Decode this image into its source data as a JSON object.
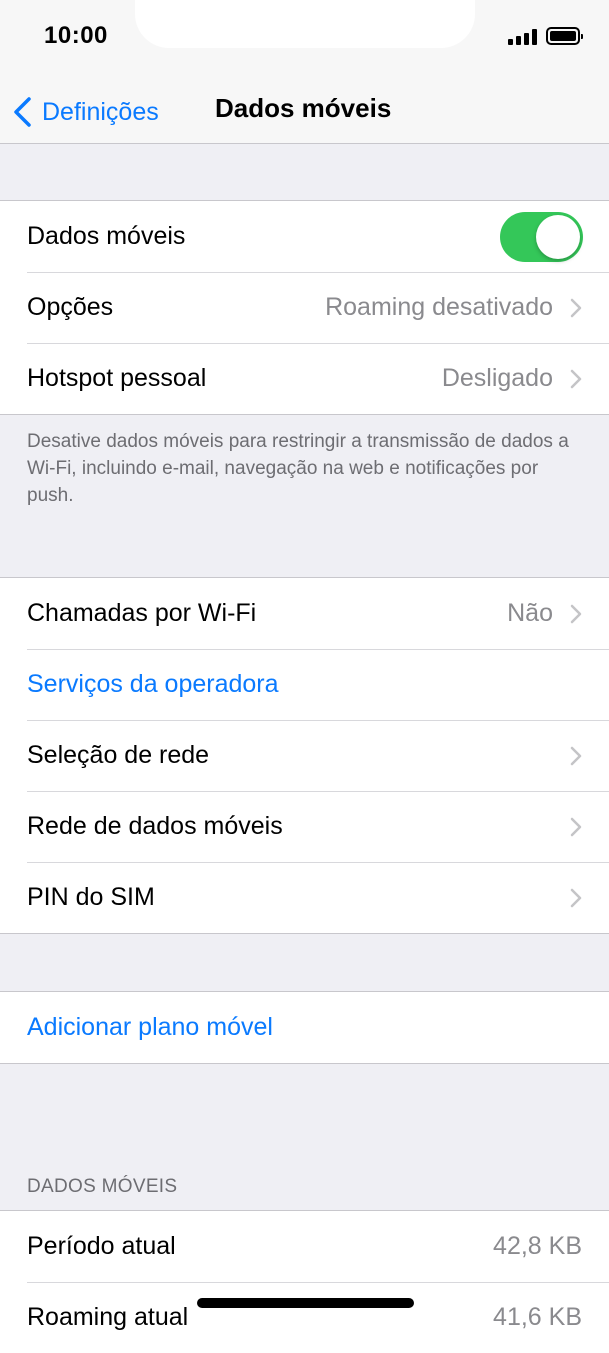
{
  "status_bar": {
    "time": "10:00"
  },
  "nav": {
    "back_label": "Definições",
    "title": "Dados móveis"
  },
  "group1": {
    "cellular_data_label": "Dados móveis",
    "cellular_data_enabled": true,
    "options_label": "Opções",
    "options_value": "Roaming desativado",
    "hotspot_label": "Hotspot pessoal",
    "hotspot_value": "Desligado"
  },
  "group1_footer": "Desative dados móveis para restringir a transmissão de dados a Wi-Fi, incluindo e-mail, navegação na web e notificações por push.",
  "group2": {
    "wifi_calling_label": "Chamadas por Wi-Fi",
    "wifi_calling_value": "Não",
    "carrier_services_label": "Serviços da operadora",
    "network_selection_label": "Seleção de rede",
    "cellular_network_label": "Rede de dados móveis",
    "sim_pin_label": "PIN do SIM"
  },
  "group3": {
    "add_plan_label": "Adicionar plano móvel"
  },
  "usage": {
    "header": "DADOS MÓVEIS",
    "current_period_label": "Período atual",
    "current_period_value": "42,8 KB",
    "roaming_label": "Roaming atual",
    "roaming_value": "41,6 KB"
  },
  "colors": {
    "accent": "#0a7aff",
    "toggle_on": "#34c759",
    "background": "#efeff4"
  }
}
